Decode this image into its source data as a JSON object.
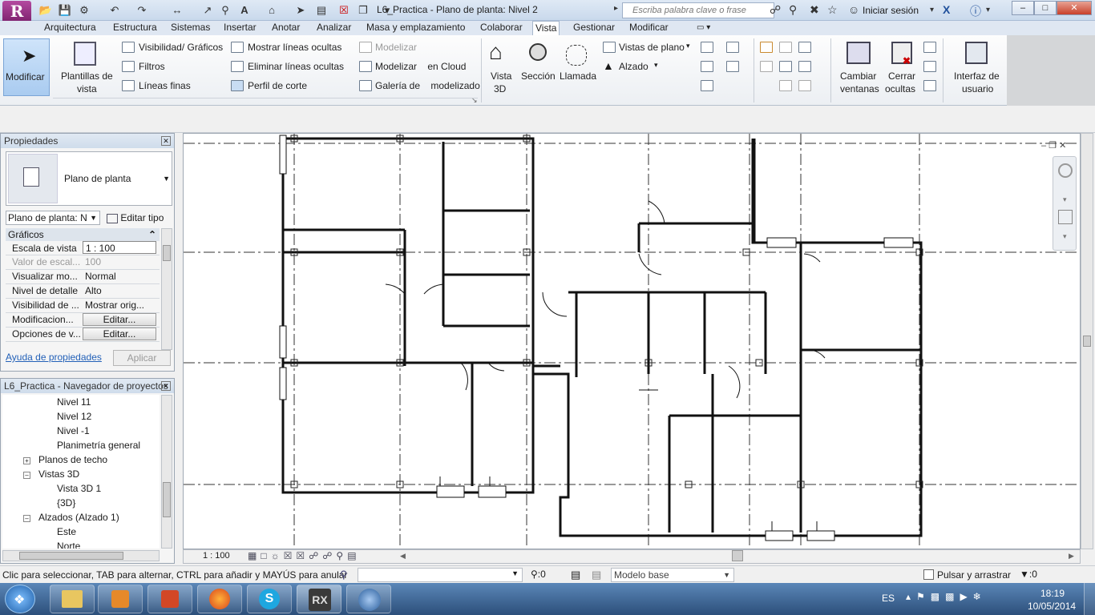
{
  "app": {
    "logo": "R",
    "title": "L6_Practica - Plano de planta: Nivel 2",
    "search_placeholder": "Escriba palabra clave o frase",
    "signin": "Iniciar sesión",
    "window_min": "–",
    "window_max": "□",
    "window_close": "✕"
  },
  "tabs": [
    "Arquitectura",
    "Estructura",
    "Sistemas",
    "Insertar",
    "Anotar",
    "Analizar",
    "Masa y emplazamiento",
    "Colaborar",
    "Vista",
    "Gestionar",
    "Modificar"
  ],
  "active_tab": "Vista",
  "ribbon": {
    "modify": "Modificar",
    "templates": [
      "Plantillas de",
      "vista"
    ],
    "graphics": [
      "Visibilidad/ Gráficos",
      "Filtros",
      "Líneas finas"
    ],
    "lines": [
      "Mostrar líneas ocultas",
      "Eliminar líneas ocultas",
      "Perfil de corte"
    ],
    "render": [
      "Modelizar",
      "Modelizar",
      "en Cloud",
      "Galería de",
      "modelizado"
    ],
    "view3d": [
      "Vista",
      "3D"
    ],
    "section": "Sección",
    "callout": "Llamada",
    "plan_views": "Vistas de plano",
    "elevation": "Alzado",
    "switch_windows": [
      "Cambiar",
      "ventanas"
    ],
    "close_hidden": [
      "Cerrar",
      "ocultas"
    ],
    "user_interface": [
      "Interfaz de",
      "usuario"
    ]
  },
  "properties": {
    "title": "Propiedades",
    "type_name": "Plano de planta",
    "instance_selector": "Plano de planta: N",
    "edit_type": "Editar tipo",
    "group": "Gráficos",
    "rows": [
      {
        "label": "Escala de vista",
        "value": "1 : 100"
      },
      {
        "label": "Valor de escal...",
        "value": "100"
      },
      {
        "label": "Visualizar mo...",
        "value": "Normal"
      },
      {
        "label": "Nivel de detalle",
        "value": "Alto"
      },
      {
        "label": "Visibilidad de ...",
        "value": "Mostrar orig..."
      },
      {
        "label": "Modificacion...",
        "value": "Editar..."
      },
      {
        "label": "Opciones de v...",
        "value": "Editar..."
      }
    ],
    "help_link": "Ayuda de propiedades",
    "apply": "Aplicar"
  },
  "browser": {
    "title": "L6_Practica - Navegador de proyectos",
    "items": [
      "Nivel 11",
      "Nivel 12",
      "Nivel -1",
      "Planimetría general",
      "Planos de techo",
      "Vistas 3D",
      "Vista 3D 1",
      "{3D}",
      "Alzados (Alzado 1)",
      "Este",
      "Norte"
    ]
  },
  "viewbar": {
    "scale": "1 : 100"
  },
  "status": {
    "hint": "Clic para seleccionar, TAB para alternar, CTRL para añadir y MAYÚS para anular",
    "sel_count": ":0",
    "model": "Modelo base",
    "press_drag": "Pulsar y arrastrar",
    "filter_count": ":0"
  },
  "taskbar": {
    "lang": "ES",
    "time": "18:19",
    "date": "10/05/2014"
  }
}
